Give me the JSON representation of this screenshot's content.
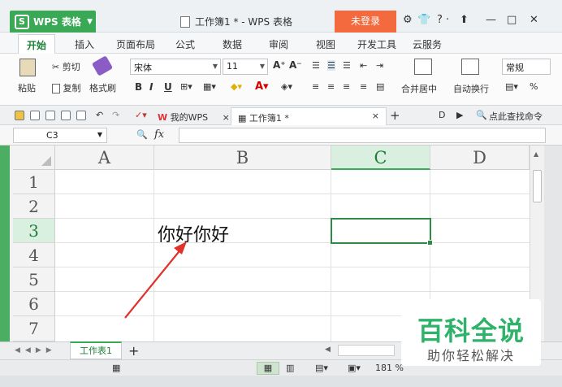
{
  "window": {
    "app_menu_label": "WPS 表格",
    "doc_title": "工作簿1 * - WPS 表格",
    "login_label": "未登录",
    "toolbar_right": "? ·",
    "colors": {
      "brand_green": "#3aa955",
      "login_orange": "#f26a3d",
      "selected_header": "#d9efdf",
      "active_cell_border": "#2e8b47"
    }
  },
  "ribbon_tabs": [
    "开始",
    "插入",
    "页面布局",
    "公式",
    "数据",
    "审阅",
    "视图",
    "开发工具",
    "云服务"
  ],
  "ribbon": {
    "paste_label": "粘贴",
    "cut_label": "剪切",
    "copy_label": "复制",
    "format_painter_label": "格式刷",
    "font_name": "宋体",
    "font_size": "11",
    "bold_label": "B",
    "italic_label": "I",
    "underline_label": "U",
    "merge_center_label": "合并居中",
    "wrap_text_label": "自动换行",
    "number_format": "常规",
    "percent_label": "%"
  },
  "quickbar": {
    "doc_tab_1": "我的WPS",
    "doc_tab_2": "工作簿1 *",
    "search_label": "点此查找命令"
  },
  "formula_bar": {
    "cell_ref": "C3",
    "fx_label": "fx",
    "formula_value": ""
  },
  "grid": {
    "columns": [
      "A",
      "B",
      "C",
      "D"
    ],
    "rows": [
      "1",
      "2",
      "3",
      "4",
      "5",
      "6",
      "7"
    ],
    "selected_cell": "C3",
    "cells": {
      "B3": "你好你好"
    }
  },
  "sheets": {
    "tabs": [
      "工作表1"
    ],
    "add_label": "+"
  },
  "status": {
    "zoom": "181 %"
  },
  "watermark": {
    "title": "百科全说",
    "subtitle": "助你轻松解决"
  }
}
